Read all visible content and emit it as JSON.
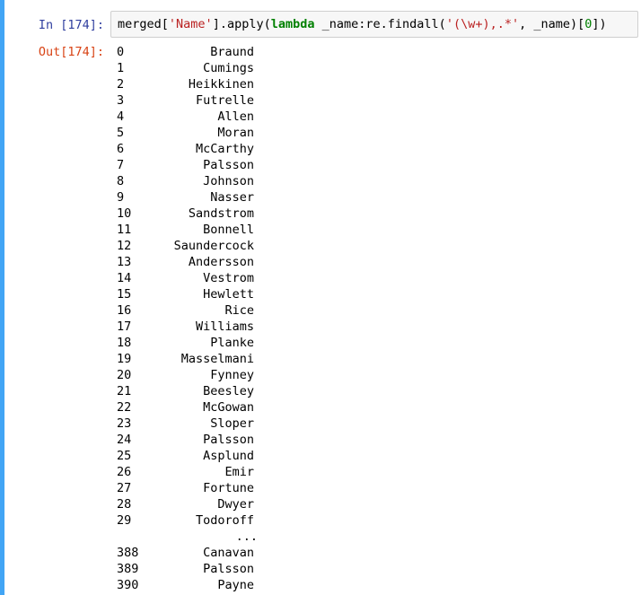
{
  "in_prompt": "In [174]:",
  "out_prompt": "Out[174]:",
  "code": {
    "segments": [
      {
        "text": "merged[",
        "kind": "plain"
      },
      {
        "text": "'Name'",
        "kind": "str"
      },
      {
        "text": "].apply(",
        "kind": "plain"
      },
      {
        "text": "lambda",
        "kind": "kw"
      },
      {
        "text": " _name:re.findall(",
        "kind": "plain"
      },
      {
        "text": "'(\\w+),.*'",
        "kind": "str"
      },
      {
        "text": ", _name)[",
        "kind": "plain"
      },
      {
        "text": "0",
        "kind": "num"
      },
      {
        "text": "])",
        "kind": "plain"
      }
    ]
  },
  "output": {
    "rows": [
      {
        "index": "0",
        "value": "Braund"
      },
      {
        "index": "1",
        "value": "Cumings"
      },
      {
        "index": "2",
        "value": "Heikkinen"
      },
      {
        "index": "3",
        "value": "Futrelle"
      },
      {
        "index": "4",
        "value": "Allen"
      },
      {
        "index": "5",
        "value": "Moran"
      },
      {
        "index": "6",
        "value": "McCarthy"
      },
      {
        "index": "7",
        "value": "Palsson"
      },
      {
        "index": "8",
        "value": "Johnson"
      },
      {
        "index": "9",
        "value": "Nasser"
      },
      {
        "index": "10",
        "value": "Sandstrom"
      },
      {
        "index": "11",
        "value": "Bonnell"
      },
      {
        "index": "12",
        "value": "Saundercock"
      },
      {
        "index": "13",
        "value": "Andersson"
      },
      {
        "index": "14",
        "value": "Vestrom"
      },
      {
        "index": "15",
        "value": "Hewlett"
      },
      {
        "index": "16",
        "value": "Rice"
      },
      {
        "index": "17",
        "value": "Williams"
      },
      {
        "index": "18",
        "value": "Planke"
      },
      {
        "index": "19",
        "value": "Masselmani"
      },
      {
        "index": "20",
        "value": "Fynney"
      },
      {
        "index": "21",
        "value": "Beesley"
      },
      {
        "index": "22",
        "value": "McGowan"
      },
      {
        "index": "23",
        "value": "Sloper"
      },
      {
        "index": "24",
        "value": "Palsson"
      },
      {
        "index": "25",
        "value": "Asplund"
      },
      {
        "index": "26",
        "value": "Emir"
      },
      {
        "index": "27",
        "value": "Fortune"
      },
      {
        "index": "28",
        "value": "Dwyer"
      },
      {
        "index": "29",
        "value": "Todoroff"
      },
      {
        "index": "",
        "value": "...",
        "ellipsis": true
      },
      {
        "index": "388",
        "value": "Canavan"
      },
      {
        "index": "389",
        "value": "Palsson"
      },
      {
        "index": "390",
        "value": "Payne"
      }
    ]
  },
  "colors": {
    "cell_bar": "#42a5f5",
    "in_prompt": "#303f9f",
    "out_prompt": "#d84315",
    "string": "#ba2121",
    "keyword": "#008000",
    "number": "#008000"
  }
}
